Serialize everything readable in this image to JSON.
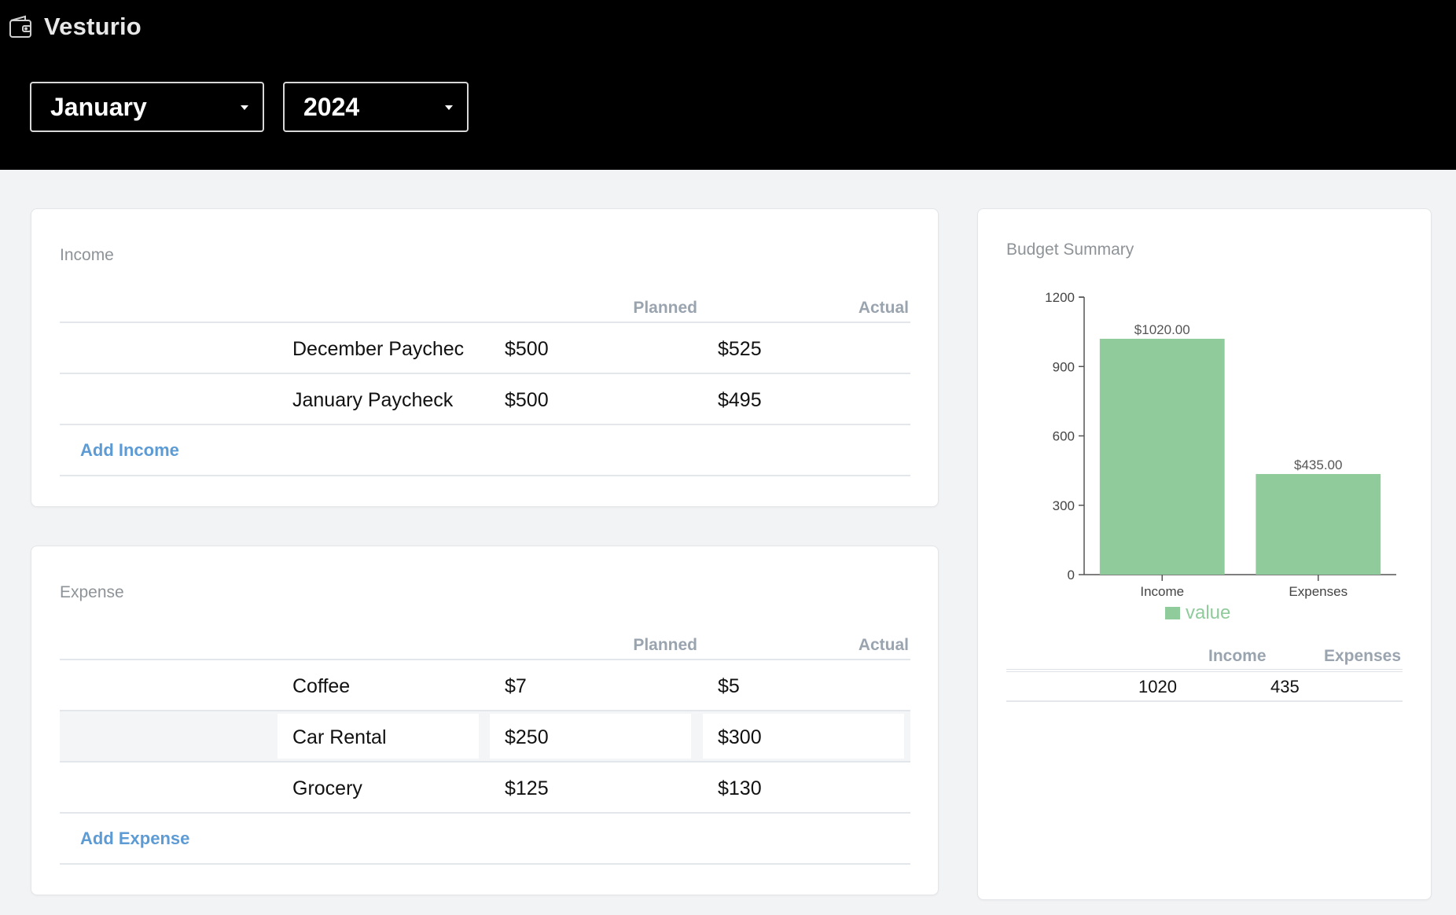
{
  "app": {
    "name": "Vesturio"
  },
  "filters": {
    "month": "January",
    "year": "2024"
  },
  "income": {
    "title": "Income",
    "columns": {
      "planned": "Planned",
      "actual": "Actual"
    },
    "rows": [
      {
        "name": "December Paychec",
        "planned": "$500",
        "actual": "$525"
      },
      {
        "name": "January Paycheck",
        "planned": "$500",
        "actual": "$495"
      }
    ],
    "add_label": "Add Income"
  },
  "expense": {
    "title": "Expense",
    "columns": {
      "planned": "Planned",
      "actual": "Actual"
    },
    "rows": [
      {
        "name": "Coffee",
        "planned": "$7",
        "actual": "$5"
      },
      {
        "name": "Car Rental",
        "planned": "$250",
        "actual": "$300"
      },
      {
        "name": "Grocery",
        "planned": "$125",
        "actual": "$130"
      }
    ],
    "add_label": "Add Expense"
  },
  "summary": {
    "title": "Budget Summary",
    "table": {
      "headers": [
        "Income",
        "Expenses"
      ],
      "values": [
        "1020",
        "435"
      ]
    }
  },
  "colors": {
    "bar": "#8fcb9b",
    "link": "#5d9bd5",
    "header_bg": "#000000"
  },
  "chart_data": {
    "type": "bar",
    "title": "",
    "categories": [
      "Income",
      "Expenses"
    ],
    "series": [
      {
        "name": "value",
        "values": [
          1020,
          435
        ]
      }
    ],
    "data_labels": [
      "$1020.00",
      "$435.00"
    ],
    "yticks": [
      "0",
      "300",
      "600",
      "900",
      "1200"
    ],
    "ylim": [
      0,
      1200
    ],
    "legend": "bottom",
    "grid": false
  }
}
